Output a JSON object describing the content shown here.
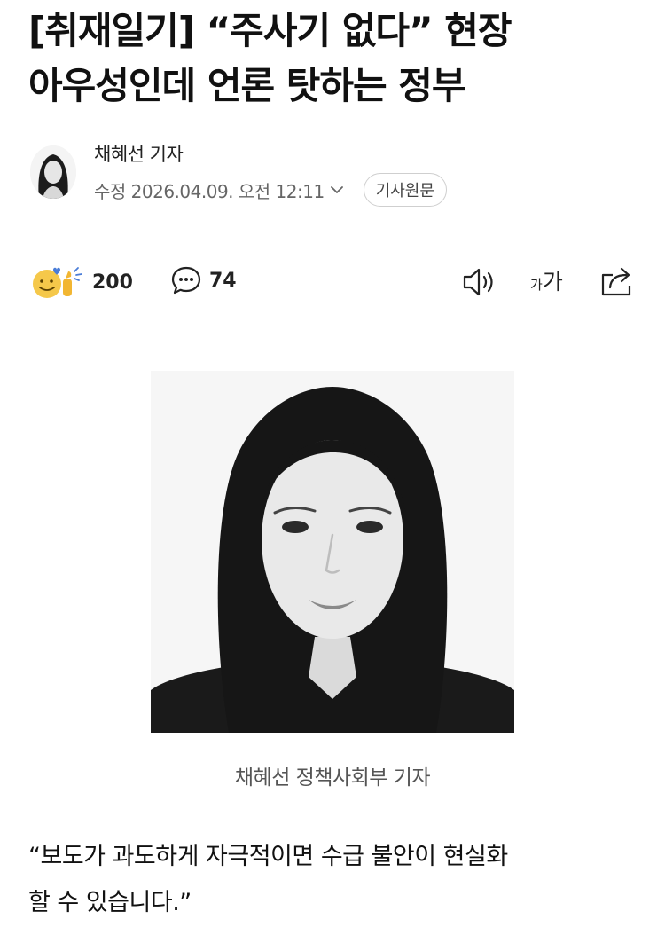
{
  "article": {
    "headline_line1": "[취재일기] “주사기 없다” 현장",
    "headline_line2": "아우성인데 언론 탓하는 정부",
    "author": "채혜선 기자",
    "date": "수정 2026.04.09. 오전 12:11",
    "original_button": "기사원문",
    "photo_caption": "채혜선 정책사회부 기자",
    "body_line1": "“보도가 과도하게 자극적이면 수급 불안이 현실화",
    "body_line2": "할 수 있습니다.”"
  },
  "actions": {
    "reactions_count": "200",
    "comments_count": "74",
    "font_size_label_small": "가",
    "font_size_label_large": "가"
  },
  "icons": {
    "reaction": "reaction-emoji-icon",
    "comment": "comment-bubble-icon",
    "tts": "speaker-icon",
    "font_size": "font-size-icon",
    "share": "share-icon",
    "date_toggle": "chevron-down-icon"
  },
  "colors": {
    "text": "#111111",
    "meta": "#666666",
    "reaction_face": "#f5c84a",
    "reaction_heart": "#4a7dd8"
  }
}
